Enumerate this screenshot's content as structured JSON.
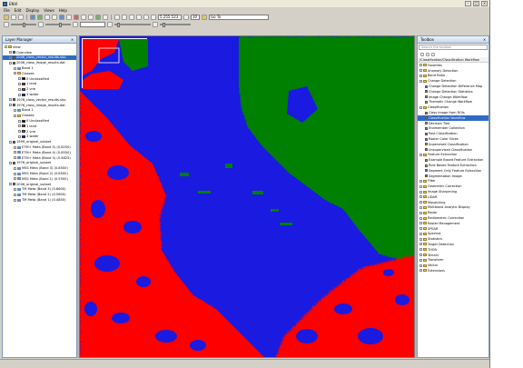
{
  "window": {
    "title": "ENVI"
  },
  "menu": [
    "File",
    "Edit",
    "Display",
    "Views",
    "Help"
  ],
  "toolbar": {
    "zoom_value": "5.255.523",
    "percent_value": "30",
    "goto_placeholder": "Go To"
  },
  "layer_manager": {
    "title": "Layer Manager",
    "rows": [
      {
        "indent": 0,
        "type": "folder",
        "label": "View"
      },
      {
        "indent": 1,
        "type": "check",
        "label": "Overview"
      },
      {
        "indent": 1,
        "type": "check",
        "label": "2006_class_vector_results.shp",
        "selected": true
      },
      {
        "indent": 1,
        "type": "check",
        "label": "2006_class_image_results.dat"
      },
      {
        "indent": 2,
        "type": "layer",
        "label": "Band 1"
      },
      {
        "indent": 2,
        "type": "folder",
        "label": "Classes"
      },
      {
        "indent": 3,
        "type": "swatch",
        "color": "#000000",
        "label": "0 Unclassified"
      },
      {
        "indent": 3,
        "type": "swatch",
        "color": "#ff0000",
        "label": "1 land"
      },
      {
        "indent": 3,
        "type": "swatch",
        "color": "#00a000",
        "label": "2 vne"
      },
      {
        "indent": 3,
        "type": "swatch",
        "color": "#1010e0",
        "label": "3 water"
      },
      {
        "indent": 1,
        "type": "check",
        "label": "1976_class_vector_results.shp"
      },
      {
        "indent": 1,
        "type": "check",
        "label": "1976_class_image_results.dat"
      },
      {
        "indent": 2,
        "type": "layer",
        "label": "Band 1"
      },
      {
        "indent": 2,
        "type": "folder",
        "label": "Classes"
      },
      {
        "indent": 3,
        "type": "swatch",
        "color": "#000000",
        "label": "0 Unclassified"
      },
      {
        "indent": 3,
        "type": "swatch",
        "color": "#ff0000",
        "label": "1 land"
      },
      {
        "indent": 3,
        "type": "swatch",
        "color": "#00a000",
        "label": "2 vne"
      },
      {
        "indent": 3,
        "type": "swatch",
        "color": "#1010e0",
        "label": "3 water"
      },
      {
        "indent": 1,
        "type": "check",
        "label": "1999_original_subset"
      },
      {
        "indent": 2,
        "type": "layer",
        "label": "ETM+ Meta (Band 5) (0.8250)"
      },
      {
        "indent": 2,
        "type": "layer",
        "label": "ETM+ Meta (Band 4) (0.6550)"
      },
      {
        "indent": 2,
        "type": "layer",
        "label": "ETM+ Meta (Band 3) (0.4825)"
      },
      {
        "indent": 1,
        "type": "check",
        "label": "1976_original_subset"
      },
      {
        "indent": 2,
        "type": "layer",
        "label": "MSS Meta (Band 3) (0.8500)"
      },
      {
        "indent": 2,
        "type": "layer",
        "label": "MSS Meta (Band 2) (0.6500)"
      },
      {
        "indent": 2,
        "type": "layer",
        "label": "MSS Meta (Band 1) (0.5500)"
      },
      {
        "indent": 1,
        "type": "check",
        "label": "2006_original_subset"
      },
      {
        "indent": 2,
        "type": "layer",
        "label": "TM Meta (Band 3) (0.6600)"
      },
      {
        "indent": 2,
        "type": "layer",
        "label": "TM Meta (Band 2) (0.5600)"
      },
      {
        "indent": 2,
        "type": "layer",
        "label": "TM Meta (Band 1) (0.4850)"
      }
    ]
  },
  "toolbox": {
    "title": "Toolbox",
    "search_placeholder": "Search the toolbox",
    "path": "/Classification/Classification Workflow",
    "rows": [
      {
        "indent": 0,
        "type": "folder",
        "label": "Favorites"
      },
      {
        "indent": 0,
        "type": "folder",
        "label": "Anomaly Detection"
      },
      {
        "indent": 0,
        "type": "folder",
        "label": "Band Ratio"
      },
      {
        "indent": 0,
        "type": "folder",
        "label": "Change Detection"
      },
      {
        "indent": 1,
        "type": "tool",
        "label": "Change Detection Difference Map"
      },
      {
        "indent": 1,
        "type": "tool",
        "label": "Change Detection Statistics"
      },
      {
        "indent": 1,
        "type": "tool",
        "label": "Image Change Workflow"
      },
      {
        "indent": 1,
        "type": "tool",
        "label": "Thematic Change Workflow"
      },
      {
        "indent": 0,
        "type": "folder",
        "label": "Classification"
      },
      {
        "indent": 1,
        "type": "tool",
        "label": "Class Image from ROIs"
      },
      {
        "indent": 1,
        "type": "tool",
        "label": "Classification Workflow",
        "selected": true
      },
      {
        "indent": 1,
        "type": "tool",
        "label": "Decision Tree"
      },
      {
        "indent": 1,
        "type": "tool",
        "label": "Endmember Collection"
      },
      {
        "indent": 1,
        "type": "tool",
        "label": "Post Classification"
      },
      {
        "indent": 1,
        "type": "tool",
        "label": "Raster Color Slices"
      },
      {
        "indent": 1,
        "type": "tool",
        "label": "Supervised Classification"
      },
      {
        "indent": 1,
        "type": "tool",
        "label": "Unsupervised Classification"
      },
      {
        "indent": 0,
        "type": "folder",
        "label": "Feature Extraction"
      },
      {
        "indent": 1,
        "type": "tool",
        "label": "Example Based Feature Extraction"
      },
      {
        "indent": 1,
        "type": "tool",
        "label": "Rule Based Feature Extraction"
      },
      {
        "indent": 1,
        "type": "tool",
        "label": "Segment Only Feature Extraction"
      },
      {
        "indent": 1,
        "type": "tool",
        "label": "Segmentation Image"
      },
      {
        "indent": 0,
        "type": "folder",
        "label": "Filter"
      },
      {
        "indent": 0,
        "type": "folder",
        "label": "Geometric Correction"
      },
      {
        "indent": 0,
        "type": "folder",
        "label": "Image Sharpening"
      },
      {
        "indent": 0,
        "type": "folder",
        "label": "LiDAR"
      },
      {
        "indent": 0,
        "type": "folder",
        "label": "Mosaicking"
      },
      {
        "indent": 0,
        "type": "folder",
        "label": "Multiband Analytic Display"
      },
      {
        "indent": 0,
        "type": "folder",
        "label": "Radar"
      },
      {
        "indent": 0,
        "type": "folder",
        "label": "Radiometric Correction"
      },
      {
        "indent": 0,
        "type": "folder",
        "label": "Raster Management"
      },
      {
        "indent": 0,
        "type": "folder",
        "label": "SPEAR"
      },
      {
        "indent": 0,
        "type": "folder",
        "label": "Spectral"
      },
      {
        "indent": 0,
        "type": "folder",
        "label": "Statistics"
      },
      {
        "indent": 0,
        "type": "folder",
        "label": "Target Detection"
      },
      {
        "indent": 0,
        "type": "folder",
        "label": "THOR"
      },
      {
        "indent": 0,
        "type": "folder",
        "label": "Terrain"
      },
      {
        "indent": 0,
        "type": "folder",
        "label": "Transform"
      },
      {
        "indent": 0,
        "type": "folder",
        "label": "Vector"
      },
      {
        "indent": 0,
        "type": "folder",
        "label": "Extensions"
      }
    ]
  },
  "colors": {
    "land": "#ff0000",
    "vegetation": "#008000",
    "water": "#1a1ae0"
  }
}
